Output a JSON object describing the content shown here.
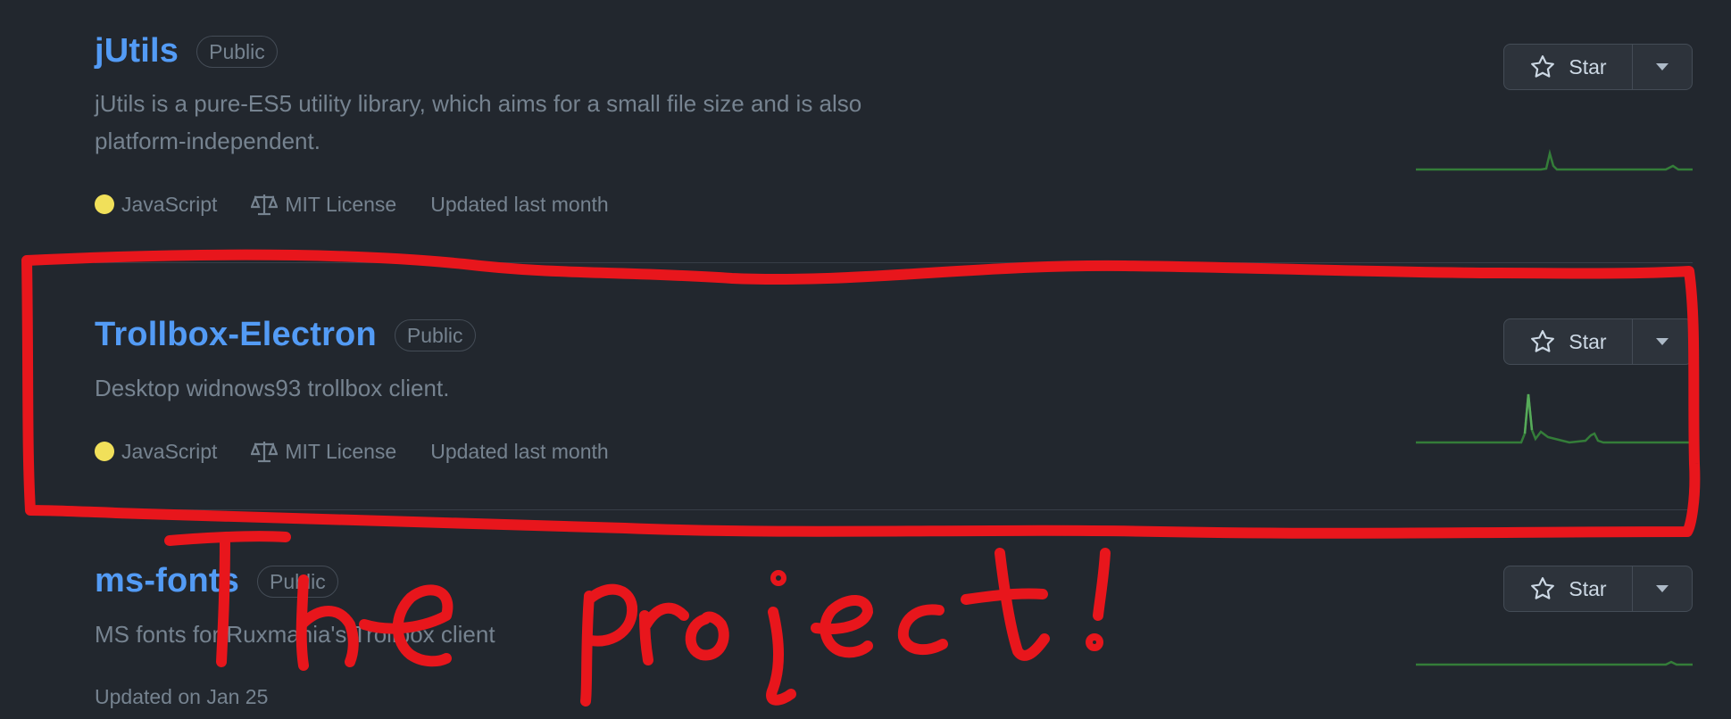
{
  "repos": [
    {
      "name": "jUtils",
      "visibility": "Public",
      "description_line1": "jUtils is a pure-ES5 utility library, which aims for a small file size and is also",
      "description_line2": "platform-independent.",
      "language": "JavaScript",
      "language_color": "#f1e05a",
      "license": "MIT License",
      "updated": "Updated last month"
    },
    {
      "name": "Trollbox-Electron",
      "visibility": "Public",
      "description_line1": "Desktop widnows93 trollbox client.",
      "language": "JavaScript",
      "language_color": "#f1e05a",
      "license": "MIT License",
      "updated": "Updated last month"
    },
    {
      "name": "ms-fonts",
      "visibility": "Public",
      "description_line1": "MS fonts for Ruxmania's Trollbox client",
      "updated": "Updated on Jan 25"
    }
  ],
  "star_label": "Star",
  "icons": {
    "star": "star-icon",
    "caret": "triangle-down-icon",
    "license": "law-icon"
  },
  "colors": {
    "link": "#539bf5",
    "annotation": "#e8161c",
    "spark": "#347d39"
  },
  "annotation_text": "The project!"
}
